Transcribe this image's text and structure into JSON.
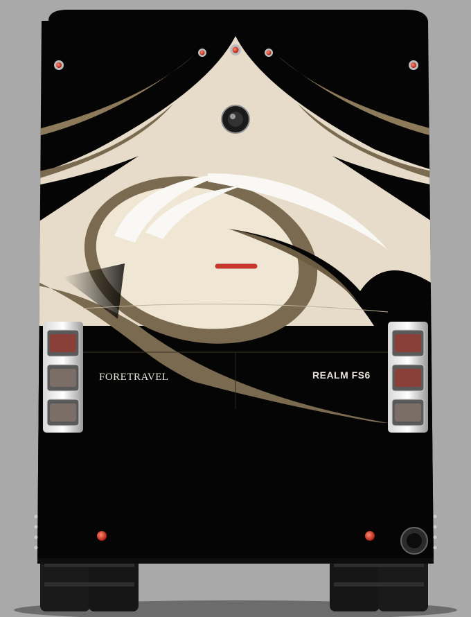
{
  "image": {
    "subject": "Rear view of a motorcoach",
    "background_color": "#a9a9a9",
    "body_color": "#050505",
    "accent_colors": {
      "cream": "#e6dcc9",
      "tan": "#7a6a4f",
      "white_swoosh": "#f8f6f1",
      "light_red": "#c8372a"
    }
  },
  "badges": {
    "brand": "FORETRAVEL",
    "model": "REALM  FS6"
  }
}
